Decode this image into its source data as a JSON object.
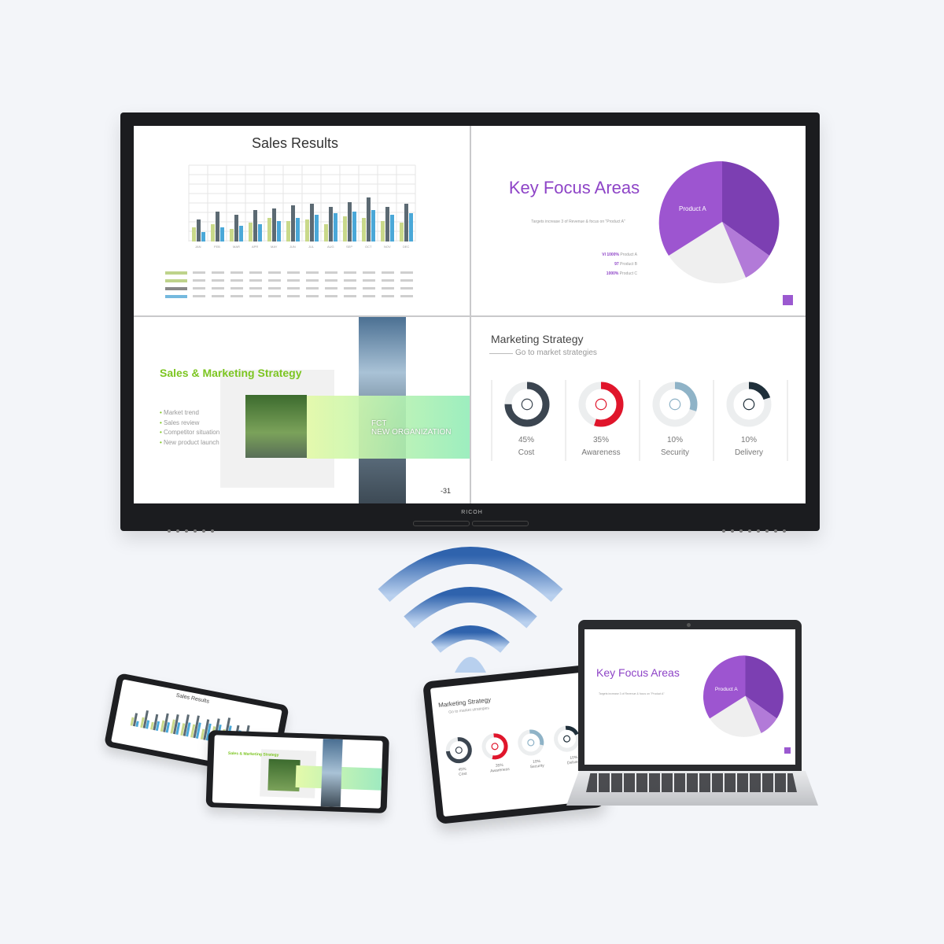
{
  "main_display": {
    "brand": "RICOH",
    "sales_results": {
      "title": "Sales Results",
      "months": [
        "JAN",
        "FEB",
        "MAR",
        "APR",
        "MAY",
        "JUN",
        "JUL",
        "AUG",
        "SEP",
        "OCT",
        "NOV",
        "DEC"
      ]
    },
    "key_focus": {
      "title": "Key Focus Areas",
      "subtitle": "Targets increase 3 of Revenue & focus on \"Product A\"",
      "pie_label": "Product A",
      "legend": [
        {
          "value": "VI 1000%",
          "label": "Product A"
        },
        {
          "value": "97",
          "label": "Product B"
        },
        {
          "value": "1000%",
          "label": "Product C"
        }
      ]
    },
    "strategy_slide": {
      "title": "Sales & Marketing Strategy",
      "bullets": [
        "Market trend",
        "Sales review",
        "Competitor situation",
        "New product launch"
      ],
      "overlay_line1": "FCT",
      "overlay_line2": "NEW ORGANIZATION",
      "corner_mark": "-31"
    },
    "marketing": {
      "title": "Marketing Strategy",
      "subtitle": "Go to market strategies",
      "metrics": [
        {
          "pct": "45%",
          "label": "Cost",
          "fraction": 0.75,
          "color": "#3b4550",
          "icon": "clock-icon"
        },
        {
          "pct": "35%",
          "label": "Awareness",
          "fraction": 0.55,
          "color": "#e0152b",
          "icon": "megaphone-icon"
        },
        {
          "pct": "10%",
          "label": "Security",
          "fraction": 0.3,
          "color": "#8fb3c7",
          "icon": "shield-icon"
        },
        {
          "pct": "10%",
          "label": "Delivery",
          "fraction": 0.2,
          "color": "#1f2f3a",
          "icon": "truck-icon"
        }
      ]
    }
  },
  "tablet_sales": {
    "title": "Sales Results"
  },
  "tablet_strategy": {
    "title": "Sales & Marketing Strategy"
  },
  "tablet_marketing": {
    "title": "Marketing Strategy",
    "subtitle": "Go to market strategies",
    "pcts": [
      "45%",
      "35%",
      "10%",
      "10%"
    ],
    "labels": [
      "Cost",
      "Awareness",
      "Security",
      "Delivery"
    ]
  },
  "laptop": {
    "title": "Key Focus Areas",
    "subtitle": "Targets increase 3 of Revenue & focus on \"Product A\"",
    "pie_label": "Product A"
  },
  "colors": {
    "purple": "#8e44c7",
    "green": "#7cc521",
    "wifi_blue": "#3d6fb6"
  }
}
